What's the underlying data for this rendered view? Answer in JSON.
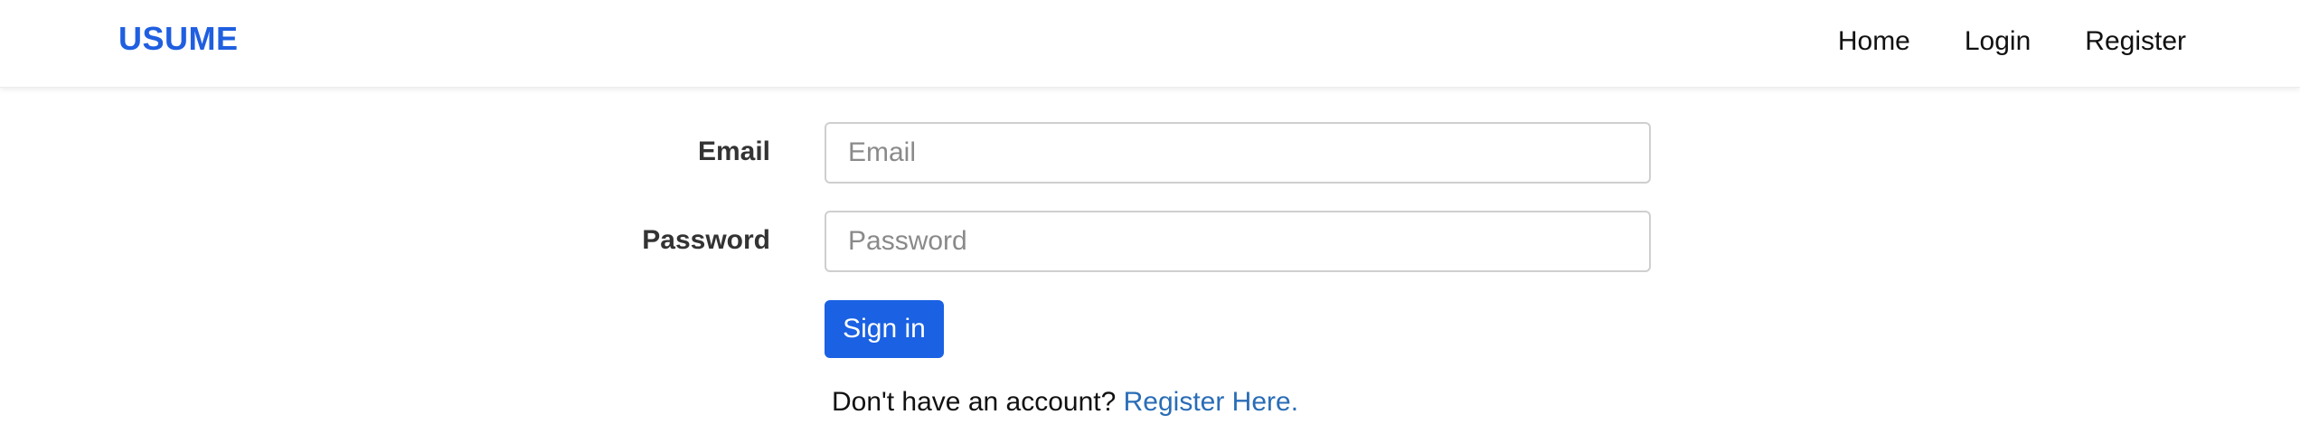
{
  "navbar": {
    "brand": "USUME",
    "links": [
      {
        "label": "Home"
      },
      {
        "label": "Login"
      },
      {
        "label": "Register"
      }
    ]
  },
  "form": {
    "email": {
      "label": "Email",
      "placeholder": "Email",
      "value": ""
    },
    "password": {
      "label": "Password",
      "placeholder": "Password",
      "value": ""
    },
    "submit_label": "Sign in",
    "register_prompt": "Don't have an account?",
    "register_link": "Register Here."
  },
  "colors": {
    "brand": "#1f5fe0",
    "primary_button": "#1a61e3",
    "link": "#2a6db6"
  }
}
